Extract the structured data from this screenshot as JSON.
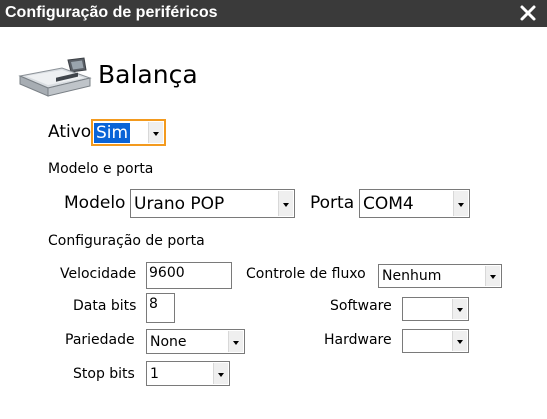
{
  "window": {
    "title": "Configuração de periféricos",
    "close_icon": "close-icon"
  },
  "device": {
    "icon": "scale-icon",
    "name": "Balança"
  },
  "ativo": {
    "label": "Ativo",
    "value": "Sim"
  },
  "modelo_porta": {
    "section_label": "Modelo e porta",
    "modelo_label": "Modelo",
    "modelo_value": "Urano POP",
    "porta_label": "Porta",
    "porta_value": "COM4"
  },
  "config_porta": {
    "section_label": "Configuração de porta",
    "velocidade_label": "Velocidade",
    "velocidade_value": "9600",
    "data_bits_label": "Data bits",
    "data_bits_value": "8",
    "pariedade_label": "Pariedade",
    "pariedade_value": "None",
    "stop_bits_label": "Stop bits",
    "stop_bits_value": "1",
    "controle_fluxo_label": "Controle de fluxo",
    "controle_fluxo_value": "Nenhum",
    "software_label": "Software",
    "software_value": "",
    "hardware_label": "Hardware",
    "hardware_value": ""
  },
  "colors": {
    "titlebar": "#3a3a3a",
    "selection": "#0a64d7",
    "focus_border": "#f39a1e"
  }
}
